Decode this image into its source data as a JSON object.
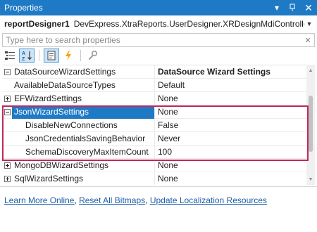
{
  "window": {
    "title": "Properties",
    "dropdown_glyph": "▾",
    "pin_glyph": "📌",
    "close_glyph": "✕"
  },
  "object_selector": {
    "name": "reportDesigner1",
    "type": "DevExpress.XtraReports.UserDesigner.XRDesignMdiController",
    "arrow": "▼"
  },
  "search": {
    "placeholder": "Type here to search properties",
    "clear_glyph": "✕"
  },
  "toolbar": {
    "buttons": [
      {
        "icon": "categorized-icon",
        "active": false
      },
      {
        "icon": "alphabetical-icon",
        "active": true
      },
      {
        "icon": "properties-icon",
        "active": true
      },
      {
        "icon": "events-icon",
        "active": false
      },
      {
        "icon": "property-pages-icon",
        "active": false
      }
    ]
  },
  "grid": {
    "rows": [
      {
        "name": "DataSourceWizardSettings",
        "value": "DataSource Wizard Settings",
        "expander": "minus",
        "bold_value": true
      },
      {
        "name": "AvailableDataSourceTypes",
        "value": "Default",
        "expander": "none"
      },
      {
        "name": "EFWizardSettings",
        "value": "None",
        "expander": "plus"
      },
      {
        "name": "JsonWizardSettings",
        "value": "None",
        "expander": "minus",
        "selected": true
      },
      {
        "name": "DisableNewConnections",
        "value": "False",
        "expander": "none",
        "child": true
      },
      {
        "name": "JsonCredentialsSavingBehavior",
        "value": "Never",
        "expander": "none",
        "child": true
      },
      {
        "name": "SchemaDiscoveryMaxItemCount",
        "value": "100",
        "expander": "none",
        "child": true
      },
      {
        "name": "MongoDBWizardSettings",
        "value": "None",
        "expander": "plus"
      },
      {
        "name": "SqlWizardSettings",
        "value": "None",
        "expander": "plus"
      }
    ]
  },
  "links": {
    "learn_more": "Learn More Online",
    "reset_bitmaps": "Reset All Bitmaps",
    "update_localization": "Update Localization Resources",
    "separator": ","
  },
  "colors": {
    "titlebar": "#1f7ac5",
    "selection": "#1f7ac5",
    "highlight_frame": "#c0285a",
    "link": "#1a5fa8"
  }
}
